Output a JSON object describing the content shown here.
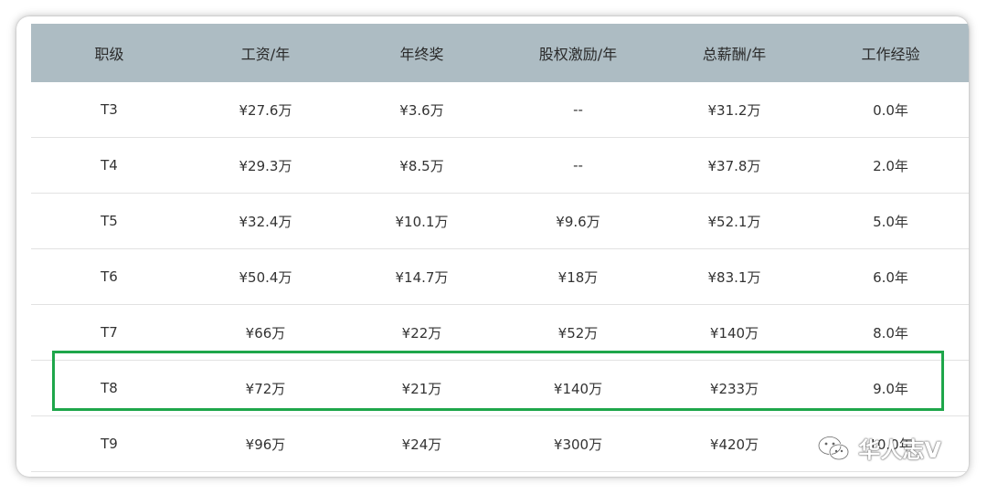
{
  "table": {
    "headers": [
      "职级",
      "工资/年",
      "年终奖",
      "股权激励/年",
      "总薪酬/年",
      "工作经验"
    ],
    "rows": [
      [
        "T3",
        "¥27.6万",
        "¥3.6万",
        "--",
        "¥31.2万",
        "0.0年"
      ],
      [
        "T4",
        "¥29.3万",
        "¥8.5万",
        "--",
        "¥37.8万",
        "2.0年"
      ],
      [
        "T5",
        "¥32.4万",
        "¥10.1万",
        "¥9.6万",
        "¥52.1万",
        "5.0年"
      ],
      [
        "T6",
        "¥50.4万",
        "¥14.7万",
        "¥18万",
        "¥83.1万",
        "6.0年"
      ],
      [
        "T7",
        "¥66万",
        "¥22万",
        "¥52万",
        "¥140万",
        "8.0年"
      ],
      [
        "T8",
        "¥72万",
        "¥21万",
        "¥140万",
        "¥233万",
        "9.0年"
      ],
      [
        "T9",
        "¥96万",
        "¥24万",
        "¥300万",
        "¥420万",
        "10.0年"
      ]
    ]
  },
  "highlight": {
    "row_label": "T8",
    "color": "#1ea64a"
  },
  "watermark": {
    "text": "华人志V",
    "icon": "wechat-icon"
  },
  "colors": {
    "header_bg": "#adbcc3",
    "border": "#e2e2e2"
  }
}
